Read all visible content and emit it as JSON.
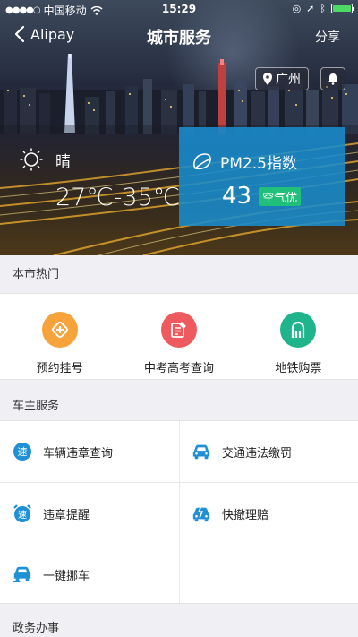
{
  "status_bar": {
    "carrier": "中国移动",
    "time": "15:29",
    "battery_level": 1.0
  },
  "nav": {
    "back_label": "Alipay",
    "title": "城市服务",
    "share_label": "分享"
  },
  "location": {
    "city": "广州"
  },
  "weather": {
    "condition": "晴",
    "temperature": "27℃-35℃"
  },
  "air": {
    "label": "PM2.5指数",
    "value": "43",
    "quality": "空气优"
  },
  "sections": {
    "hot": {
      "title": "本市热门",
      "items": [
        {
          "label": "预约挂号",
          "color": "#f5a33a",
          "icon": "plus-diamond-icon"
        },
        {
          "label": "中考高考查询",
          "color": "#ef5a5e",
          "icon": "exam-query-icon"
        },
        {
          "label": "地铁购票",
          "color": "#20b48c",
          "icon": "metro-icon"
        }
      ]
    },
    "car": {
      "title": "车主服务",
      "items": [
        {
          "label": "车辆违章查询",
          "icon": "speed-badge-icon"
        },
        {
          "label": "交通违法缴罚",
          "icon": "car-icon"
        },
        {
          "label": "违章提醒",
          "icon": "alarm-speed-icon"
        },
        {
          "label": "快撤理赔",
          "icon": "car-crash-icon"
        },
        {
          "label": "一键挪车",
          "icon": "car-move-icon"
        }
      ],
      "icon_color": "#1f8fd6"
    },
    "gov": {
      "title": "政务办事"
    }
  }
}
